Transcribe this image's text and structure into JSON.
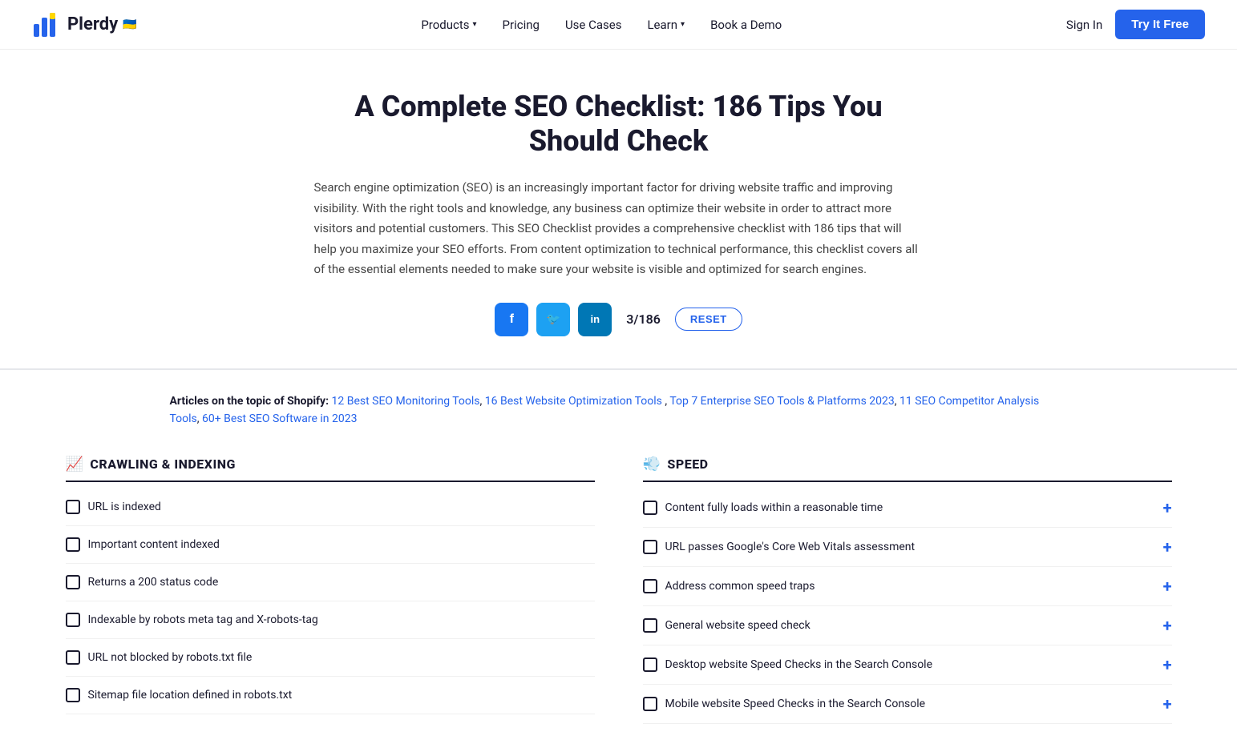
{
  "nav": {
    "logo_text": "Plerdy",
    "logo_flag": "🇺🇦",
    "links": [
      {
        "id": "products",
        "label": "Products",
        "has_chevron": true
      },
      {
        "id": "pricing",
        "label": "Pricing",
        "has_chevron": false
      },
      {
        "id": "use-cases",
        "label": "Use Cases",
        "has_chevron": false
      },
      {
        "id": "learn",
        "label": "Learn",
        "has_chevron": true
      },
      {
        "id": "book-demo",
        "label": "Book a Demo",
        "has_chevron": false
      }
    ],
    "sign_in": "Sign In",
    "try_free": "Try It Free"
  },
  "hero": {
    "title": "A Complete SEO Checklist: 186 Tips You Should Check",
    "description": "Search engine optimization (SEO) is an increasingly important factor for driving website traffic and improving visibility. With the right tools and knowledge, any business can optimize their website in order to attract more visitors and potential customers. This SEO Checklist provides a comprehensive checklist with 186 tips that will help you maximize your SEO efforts. From content optimization to technical performance, this checklist covers all of the essential elements needed to make sure your website is visible and optimized for search engines.",
    "counter": "3/186",
    "reset_label": "RESET"
  },
  "social": {
    "facebook_label": "f",
    "twitter_label": "t",
    "linkedin_label": "in"
  },
  "articles": {
    "prefix": "Articles on the topic of Shopify:",
    "links": [
      {
        "label": "12 Best SEO Monitoring Tools",
        "href": "#"
      },
      {
        "label": "16 Best Website Optimization Tools",
        "href": "#"
      },
      {
        "label": "Top 7 Enterprise SEO Tools & Platforms 2023",
        "href": "#"
      },
      {
        "label": "11 SEO Competitor Analysis Tools",
        "href": "#"
      },
      {
        "label": "60+ Best SEO Software in 2023",
        "href": "#"
      }
    ]
  },
  "crawling_section": {
    "title": "CRAWLING & INDEXING",
    "emoji": "📈",
    "items": [
      {
        "id": "ci1",
        "label": "URL is indexed"
      },
      {
        "id": "ci2",
        "label": "Important content indexed"
      },
      {
        "id": "ci3",
        "label": "Returns a 200 status code"
      },
      {
        "id": "ci4",
        "label": "Indexable by robots meta tag and X-robots-tag"
      },
      {
        "id": "ci5",
        "label": "URL not blocked by robots.txt file"
      },
      {
        "id": "ci6",
        "label": "Sitemap file location defined in robots.txt"
      }
    ]
  },
  "speed_section": {
    "title": "SPEED",
    "emoji": "💨",
    "items": [
      {
        "id": "sp1",
        "label": "Content fully loads within a reasonable time"
      },
      {
        "id": "sp2",
        "label": "URL passes Google's Core Web Vitals assessment"
      },
      {
        "id": "sp3",
        "label": "Address common speed traps"
      },
      {
        "id": "sp4",
        "label": "General website speed check"
      },
      {
        "id": "sp5",
        "label": "Desktop website Speed Checks in the Search Console"
      },
      {
        "id": "sp6",
        "label": "Mobile website Speed Checks in the Search Console"
      }
    ]
  }
}
